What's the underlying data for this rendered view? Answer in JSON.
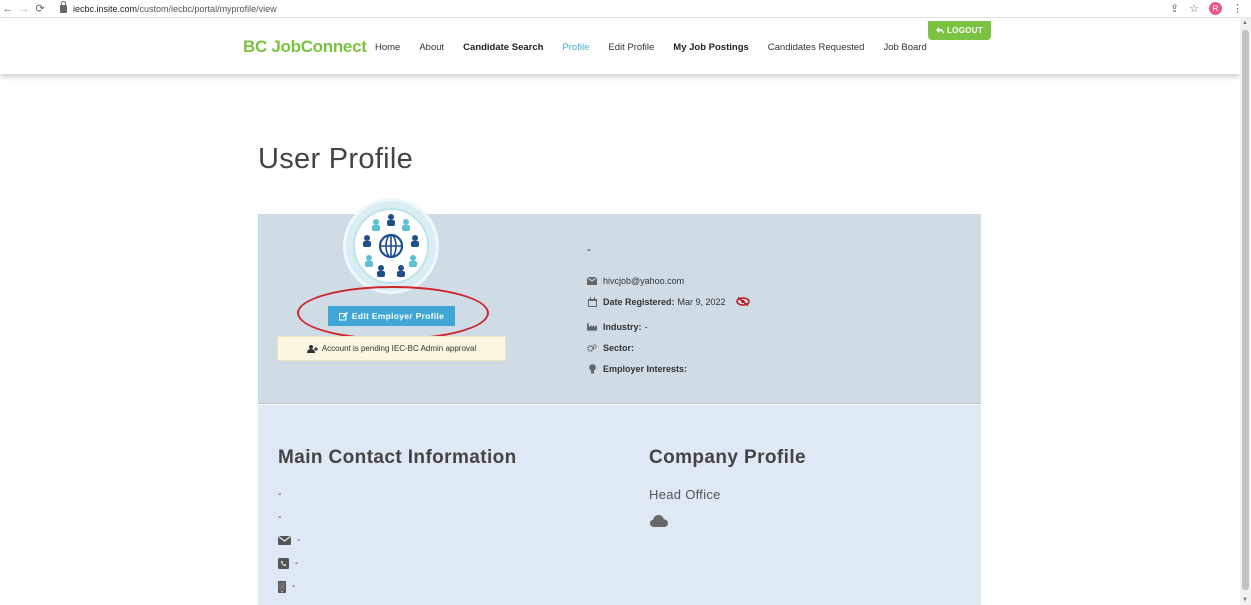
{
  "browser": {
    "url_host": "iecbc.insite.com",
    "url_path": "/custom/iecbc/portal/myprofile/view",
    "profile_initial": "R"
  },
  "header": {
    "brand": "BC JobConnect",
    "nav": [
      {
        "label": "Home"
      },
      {
        "label": "About"
      },
      {
        "label": "Candidate Search"
      },
      {
        "label": "Profile"
      },
      {
        "label": "Edit Profile"
      },
      {
        "label": "My Job Postings"
      },
      {
        "label": "Candidates Requested"
      },
      {
        "label": "Job Board"
      }
    ],
    "logout_label": "LOGOUT"
  },
  "page": {
    "title": "User Profile"
  },
  "profile": {
    "edit_button_label": "Edit Employer Profile",
    "pending_notice": "Account is pending IEC-BC Admin approval",
    "name": "-",
    "email": "hivcjob@yahoo.com",
    "date_registered_label": "Date Registered:",
    "date_registered_value": "Mar 9, 2022",
    "industry_label": "Industry:",
    "industry_value": "-",
    "sector_label": "Sector:",
    "employer_interests_label": "Employer Interests:"
  },
  "contact": {
    "title": "Main Contact Information",
    "line1": "-",
    "line2": "-",
    "email": "-",
    "phone": "-",
    "mobile": "-"
  },
  "company": {
    "title": "Company Profile",
    "head_office_label": "Head Office"
  },
  "colors": {
    "brand_green": "#7cc242",
    "active_blue": "#4ab0d6",
    "card_bg": "#cfdbe5",
    "section_bg": "#dfe9f5",
    "highlight_red": "#d0252b"
  }
}
